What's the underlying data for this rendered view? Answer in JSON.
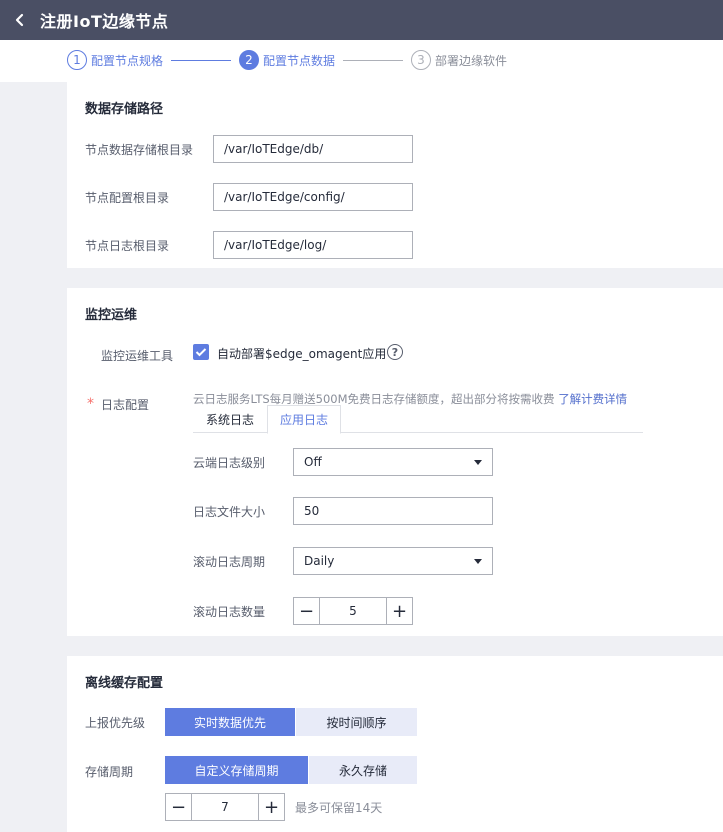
{
  "header": {
    "title": "注册IoT边缘节点"
  },
  "steps": [
    {
      "num": "1",
      "label": "配置节点规格"
    },
    {
      "num": "2",
      "label": "配置节点数据"
    },
    {
      "num": "3",
      "label": "部署边缘软件"
    }
  ],
  "storage": {
    "title": "数据存储路径",
    "fields": [
      {
        "label": "节点数据存储根目录",
        "value": "/var/IoTEdge/db/"
      },
      {
        "label": "节点配置根目录",
        "value": "/var/IoTEdge/config/"
      },
      {
        "label": "节点日志根目录",
        "value": "/var/IoTEdge/log/"
      }
    ]
  },
  "monitor": {
    "title": "监控运维",
    "tool_label": "监控运维工具",
    "tool_checkbox_label": "自动部署$edge_omagent应用",
    "log_required_mark": "*",
    "log_label": "日志配置",
    "log_notice": "云日志服务LTS每月赠送500M免费日志存储额度，超出部分将按需收费",
    "log_notice_link": "了解计费详情",
    "tabs": [
      "系统日志",
      "应用日志"
    ],
    "cloud_level_label": "云端日志级别",
    "cloud_level_value": "Off",
    "file_size_label": "日志文件大小",
    "file_size_value": "50",
    "rolling_period_label": "滚动日志周期",
    "rolling_period_value": "Daily",
    "rolling_count_label": "滚动日志数量",
    "rolling_count_value": "5"
  },
  "offline": {
    "title": "离线缓存配置",
    "priority_label": "上报优先级",
    "priority_options": [
      "实时数据优先",
      "按时间顺序"
    ],
    "period_label": "存储周期",
    "period_options": [
      "自定义存储周期",
      "永久存储"
    ],
    "period_value": "7",
    "period_hint": "最多可保留14天"
  },
  "colors": {
    "accent": "#5e7ce0",
    "header_bg": "#4a4f64",
    "required": "#f66f6a"
  }
}
